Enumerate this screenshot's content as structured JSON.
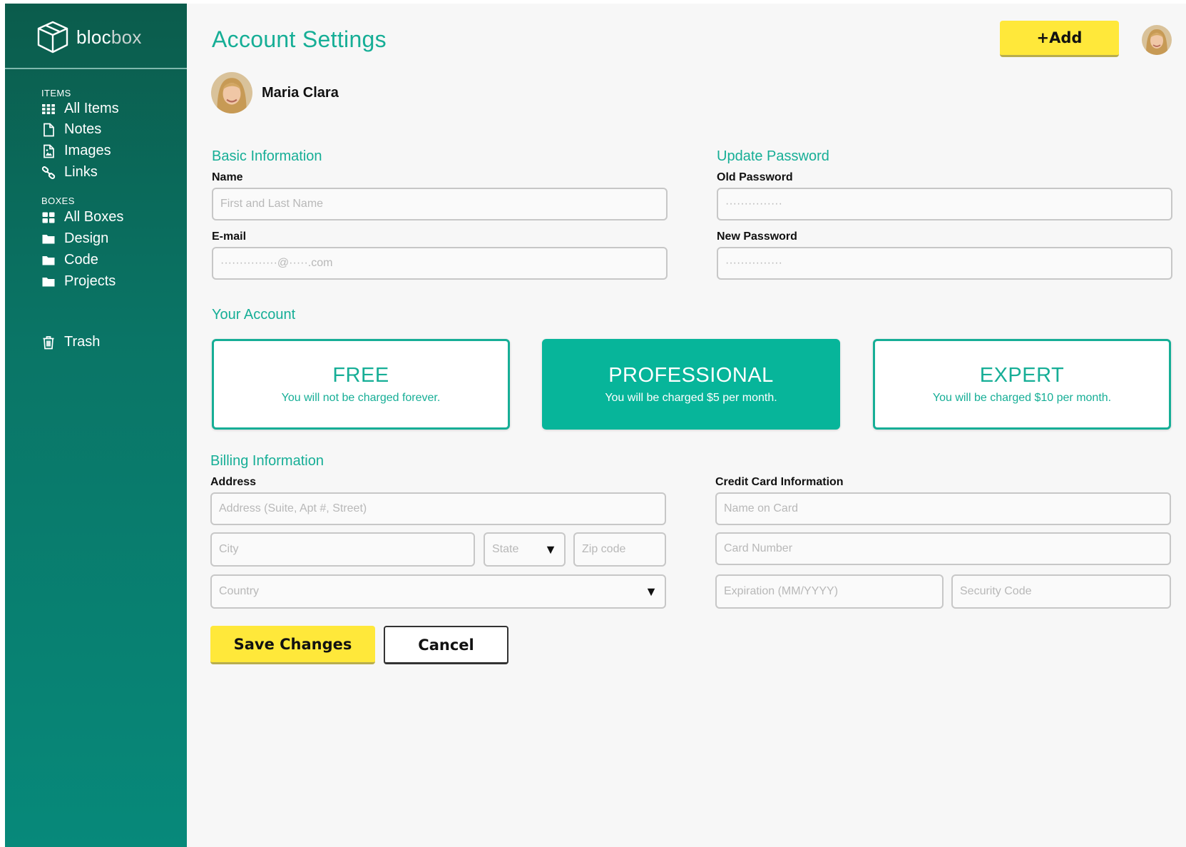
{
  "brand": {
    "name_part1": "bloc",
    "name_part2": "box"
  },
  "sidebar": {
    "items_label": "ITEMS",
    "items": [
      {
        "label": "All Items",
        "icon": "grid-icon"
      },
      {
        "label": "Notes",
        "icon": "note-icon"
      },
      {
        "label": "Images",
        "icon": "image-icon"
      },
      {
        "label": "Links",
        "icon": "link-icon"
      }
    ],
    "boxes_label": "BOXES",
    "boxes": [
      {
        "label": "All Boxes",
        "icon": "boxes-icon"
      },
      {
        "label": "Design",
        "icon": "folder-icon"
      },
      {
        "label": "Code",
        "icon": "folder-icon"
      },
      {
        "label": "Projects",
        "icon": "folder-icon"
      }
    ],
    "trash": {
      "label": "Trash",
      "icon": "trash-icon"
    }
  },
  "header": {
    "title": "Account Settings",
    "add_label": "+Add"
  },
  "profile": {
    "name": "Maria Clara"
  },
  "basic_info": {
    "heading": "Basic Information",
    "name_label": "Name",
    "name_placeholder": "First and Last Name",
    "email_label": "E-mail",
    "email_placeholder": "···············@·····.com"
  },
  "password": {
    "heading": "Update Password",
    "old_label": "Old Password",
    "old_placeholder": "···············",
    "new_label": "New Password",
    "new_placeholder": "···············"
  },
  "account": {
    "heading": "Your Account",
    "plans": [
      {
        "name": "FREE",
        "desc": "You will not be charged forever.",
        "selected": false
      },
      {
        "name": "PROFESSIONAL",
        "desc": "You will be charged $5 per month.",
        "selected": true
      },
      {
        "name": "EXPERT",
        "desc": "You will be charged $10 per month.",
        "selected": false
      }
    ]
  },
  "billing": {
    "heading": "Billing Information",
    "address_label": "Address",
    "address_placeholder": "Address (Suite, Apt #, Street)",
    "city_placeholder": "City",
    "state_placeholder": "State",
    "zip_placeholder": "Zip code",
    "country_placeholder": "Country",
    "card_label": "Credit Card Information",
    "card_name_placeholder": "Name on Card",
    "card_number_placeholder": "Card Number",
    "expiration_placeholder": "Expiration (MM/YYYY)",
    "security_placeholder": "Security Code"
  },
  "actions": {
    "save_label": "Save Changes",
    "cancel_label": "Cancel"
  },
  "colors": {
    "accent": "#16ae96",
    "sidebar_top": "#0b5c4c",
    "sidebar_bottom": "#07897a",
    "button_yellow": "#ffe83a"
  }
}
